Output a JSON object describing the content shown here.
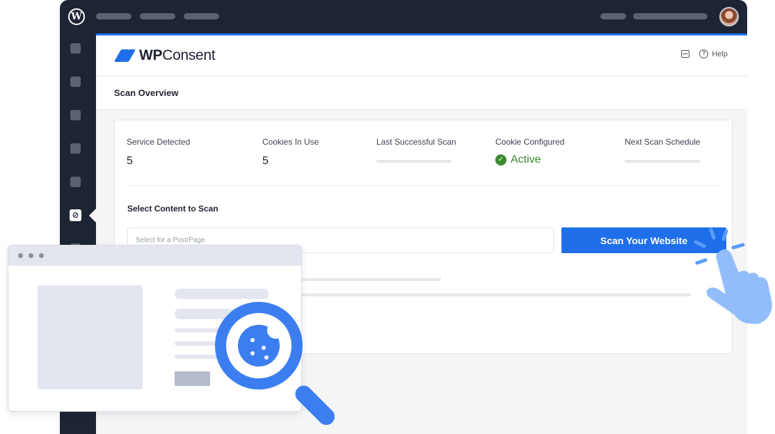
{
  "colors": {
    "admin_bar": "#1d2433",
    "brand_blue": "#1f6feb",
    "success_green": "#3a8a2e",
    "illustration_blue": "#3c7ef0",
    "hand_blue": "#93bdfa"
  },
  "topbar": {
    "logo_icon": "wordpress-logo-icon",
    "logo_glyph": "W",
    "avatar_icon": "user-avatar"
  },
  "sidebar": {
    "active_icon": "wpconsent-menu-icon",
    "active_glyph": "⊘"
  },
  "header": {
    "brand_bold": "WP",
    "brand_rest": "Consent",
    "inbox_icon": "inbox-icon",
    "help_label": "Help",
    "help_glyph": "?"
  },
  "section": {
    "title": "Scan Overview"
  },
  "stats": [
    {
      "label": "Service Detected",
      "value": "5"
    },
    {
      "label": "Cookies In Use",
      "value": "5"
    },
    {
      "label": "Last Successful Scan",
      "value": ""
    },
    {
      "label": "Cookie Configured",
      "value": "Active",
      "icon": "check-circle-icon",
      "glyph": "✓"
    },
    {
      "label": "Next Scan Schedule",
      "value": ""
    }
  ],
  "scan": {
    "content_label": "Select Content to Scan",
    "select_placeholder": "Select for a Post/Page",
    "button_label": "Scan Your Website"
  },
  "illustration": {
    "browser_icon": "browser-window-illustration",
    "magnifier_icon": "magnifier-cookie-icon",
    "hand_icon": "pointing-hand-icon"
  }
}
